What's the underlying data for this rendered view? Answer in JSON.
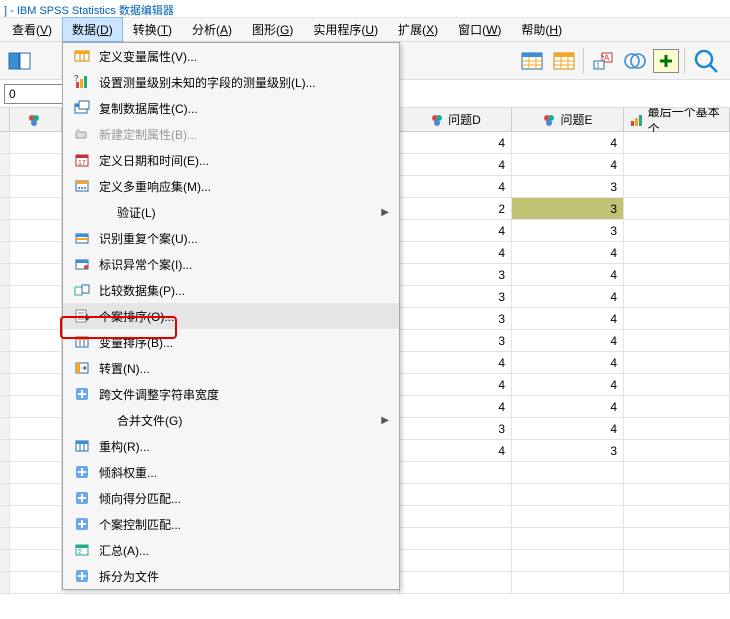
{
  "title": "] - IBM SPSS Statistics 数据编辑器",
  "menu": {
    "items": [
      {
        "label": "查看",
        "accel": "V"
      },
      {
        "label": "数据",
        "accel": "D"
      },
      {
        "label": "转换",
        "accel": "T"
      },
      {
        "label": "分析",
        "accel": "A"
      },
      {
        "label": "图形",
        "accel": "G"
      },
      {
        "label": "实用程序",
        "accel": "U"
      },
      {
        "label": "扩展",
        "accel": "X"
      },
      {
        "label": "窗口",
        "accel": "W"
      },
      {
        "label": "帮助",
        "accel": "H"
      }
    ]
  },
  "cell_value": "0",
  "columns": {
    "c0": "",
    "cD": "问题D",
    "cE": "问题E",
    "cF": "最后一个基本个"
  },
  "data": {
    "rows": [
      {
        "D": "4",
        "E": "4"
      },
      {
        "D": "4",
        "E": "4"
      },
      {
        "D": "4",
        "E": "3"
      },
      {
        "D": "2",
        "E": "3",
        "selE": true
      },
      {
        "D": "4",
        "E": "3"
      },
      {
        "D": "4",
        "E": "4"
      },
      {
        "D": "3",
        "E": "4"
      },
      {
        "D": "3",
        "E": "4"
      },
      {
        "D": "3",
        "E": "4"
      },
      {
        "D": "3",
        "E": "4"
      },
      {
        "D": "4",
        "E": "4"
      },
      {
        "D": "4",
        "E": "4"
      },
      {
        "D": "4",
        "E": "4"
      },
      {
        "D": "3",
        "E": "4"
      },
      {
        "D": "4",
        "E": "3"
      },
      {
        "D": "",
        "E": ""
      },
      {
        "D": "",
        "E": ""
      },
      {
        "D": "",
        "E": ""
      },
      {
        "D": "",
        "E": ""
      },
      {
        "D": "",
        "E": ""
      },
      {
        "D": "",
        "E": ""
      }
    ]
  },
  "dropdown": [
    {
      "icon": "define-var",
      "label": "定义变量属性(V)...",
      "name": "define-variable-properties"
    },
    {
      "icon": "set-unknown",
      "label": "设置测量级别未知的字段的测量级别(L)...",
      "name": "set-measurement-level"
    },
    {
      "icon": "copy-data",
      "label": "复制数据属性(C)...",
      "name": "copy-data-properties"
    },
    {
      "icon": "new-attr",
      "label": "新建定制属性(B)...",
      "disabled": true,
      "name": "new-custom-attribute"
    },
    {
      "icon": "date",
      "label": "定义日期和时间(E)...",
      "name": "define-dates"
    },
    {
      "icon": "multi-resp",
      "label": "定义多重响应集(M)...",
      "name": "define-multiple-response"
    },
    {
      "icon": "",
      "label": "验证(L)",
      "arrow": true,
      "indented": true,
      "name": "validation-submenu"
    },
    {
      "icon": "dup",
      "label": "识别重复个案(U)...",
      "name": "identify-duplicate-cases"
    },
    {
      "icon": "unusual",
      "label": "标识异常个案(I)...",
      "name": "identify-unusual-cases"
    },
    {
      "icon": "compare",
      "label": "比较数据集(P)...",
      "name": "compare-datasets"
    },
    {
      "icon": "sort-cases",
      "label": "个案排序(O)...",
      "hovered": true,
      "name": "sort-cases"
    },
    {
      "icon": "sort-vars",
      "label": "变量排序(B)...",
      "name": "sort-variables"
    },
    {
      "icon": "transpose",
      "label": "转置(N)...",
      "name": "transpose"
    },
    {
      "icon": "plus",
      "label": "跨文件调整字符串宽度",
      "name": "adjust-string-widths"
    },
    {
      "icon": "",
      "label": "合并文件(G)",
      "arrow": true,
      "indented": true,
      "name": "merge-files-submenu"
    },
    {
      "icon": "restructure",
      "label": "重构(R)...",
      "name": "restructure"
    },
    {
      "icon": "plus",
      "label": "倾斜权重...",
      "name": "rake-weights"
    },
    {
      "icon": "plus",
      "label": "倾向得分匹配...",
      "name": "propensity-score-matching"
    },
    {
      "icon": "plus",
      "label": "个案控制匹配...",
      "name": "case-control-matching"
    },
    {
      "icon": "aggregate",
      "label": "汇总(A)...",
      "name": "aggregate"
    },
    {
      "icon": "plus",
      "label": "拆分为文件",
      "name": "split-into-files"
    }
  ]
}
